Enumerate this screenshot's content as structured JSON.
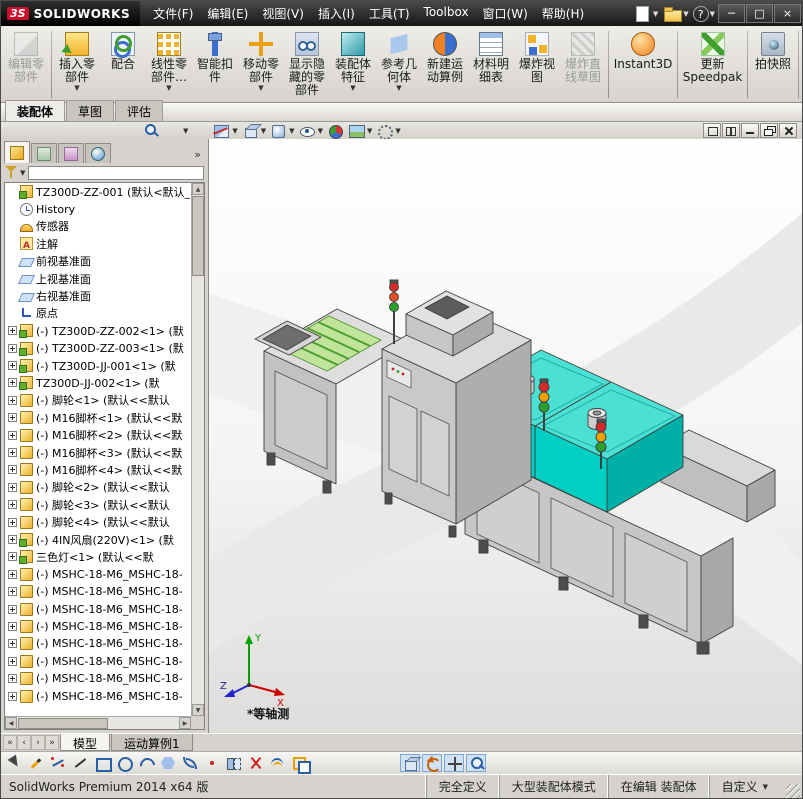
{
  "titlebar": {
    "logo_mark": "3S",
    "logo_text": "SOLIDWORKS",
    "menus": [
      "文件(F)",
      "编辑(E)",
      "视图(V)",
      "插入(I)",
      "工具(T)",
      "Toolbox",
      "窗口(W)",
      "帮助(H)"
    ],
    "quick_icons": [
      {
        "name": "new-document-icon",
        "glyph": ""
      },
      {
        "name": "open-document-icon",
        "glyph": ""
      },
      {
        "name": "help-icon",
        "glyph": "?"
      }
    ],
    "caret": "▼",
    "window_buttons": [
      {
        "name": "minimize-window-button",
        "glyph": "─"
      },
      {
        "name": "maximize-window-button",
        "glyph": "□"
      },
      {
        "name": "close-window-button",
        "glyph": "×"
      }
    ]
  },
  "ribbon": {
    "buttons": [
      {
        "name": "edit-component-button",
        "icon": "edit-component",
        "label": "编辑零\n部件",
        "disabled": true
      },
      {
        "name": "ribbon-separator",
        "icon": "sep",
        "label": "",
        "inter": "false"
      },
      {
        "name": "insert-component-button",
        "icon": "insert-component",
        "label": "插入零\n部件",
        "caret": "▼"
      },
      {
        "name": "mate-button",
        "icon": "mate",
        "label": "配合"
      },
      {
        "name": "linear-pattern-button",
        "icon": "linear-pattern",
        "label": "线性零\n部件…",
        "caret": "▼"
      },
      {
        "name": "smart-fastener-button",
        "icon": "smart-fastener",
        "label": "智能扣\n件"
      },
      {
        "name": "move-component-button",
        "icon": "move-component",
        "label": "移动零\n部件",
        "caret": "▼"
      },
      {
        "name": "show-hidden-components-button",
        "icon": "show-hidden",
        "label": "显示隐\n藏的零\n部件"
      },
      {
        "name": "assembly-features-button",
        "icon": "assembly-features",
        "label": "装配体\n特征",
        "caret": "▼"
      },
      {
        "name": "reference-geometry-button",
        "icon": "reference-geometry",
        "label": "参考几\n何体",
        "caret": "▼"
      },
      {
        "name": "new-motion-study-button",
        "icon": "motion-study",
        "label": "新建运\n动算例"
      },
      {
        "name": "bill-of-materials-button",
        "icon": "bom",
        "label": "材料明\n细表"
      },
      {
        "name": "exploded-view-button",
        "icon": "exploded-view",
        "label": "爆炸视\n图"
      },
      {
        "name": "explode-line-sketch-button",
        "icon": "explode-sketch",
        "label": "爆炸直\n线草图",
        "disabled": true
      },
      {
        "name": "ribbon-separator",
        "icon": "sep",
        "label": "",
        "inter": "false"
      },
      {
        "name": "instant3d-button",
        "icon": "instant3d",
        "label": "Instant3D"
      },
      {
        "name": "ribbon-separator",
        "icon": "sep",
        "label": "",
        "inter": "false"
      },
      {
        "name": "update-speedpak-button",
        "icon": "speedpak",
        "label": "更新\nSpeedpak"
      },
      {
        "name": "ribbon-separator",
        "icon": "sep",
        "label": "",
        "inter": "false"
      },
      {
        "name": "take-snapshot-button",
        "icon": "snapshot",
        "label": "拍快照"
      },
      {
        "name": "ribbon-separator",
        "icon": "sep",
        "label": "",
        "inter": "false"
      }
    ]
  },
  "command_tabs": [
    {
      "label": "装配体",
      "active": "true"
    },
    {
      "label": "草图",
      "active": "false"
    },
    {
      "label": "评估",
      "active": "false"
    }
  ],
  "huds": {
    "caret": "▼",
    "icons": [
      "zoom-fit-icon",
      "zoom-area-icon",
      "previous-view-icon",
      "section-view-icon",
      "view-orientation-icon",
      "display-style-icon",
      "hide-show-items-icon",
      "edit-appearance-icon",
      "apply-scene-icon",
      "view-settings-icon"
    ],
    "doc_window_buttons": [
      "doc-cascade-icon",
      "doc-tile-icon",
      "doc-minimize-icon",
      "doc-restore-icon",
      "doc-close-icon"
    ]
  },
  "panel": {
    "tabs": [
      "feature-manager-tab",
      "property-manager-tab",
      "configuration-manager-tab",
      "display-manager-tab"
    ],
    "expand_glyph": "»",
    "filter_caret": "▼"
  },
  "tree": {
    "items": [
      {
        "icon": "assembly-top",
        "label": "TZ300D-ZZ-001 (默认<默认_"
      },
      {
        "icon": "history",
        "label": "History"
      },
      {
        "icon": "sensors",
        "label": "传感器"
      },
      {
        "icon": "annotations",
        "label": "注解"
      },
      {
        "icon": "plane",
        "label": "前视基准面"
      },
      {
        "icon": "plane",
        "label": "上视基准面"
      },
      {
        "icon": "plane",
        "label": "右视基准面"
      },
      {
        "icon": "origin",
        "label": "原点"
      },
      {
        "box": "+",
        "icon": "assembly",
        "label": "(-) TZ300D-ZZ-002<1> (默"
      },
      {
        "box": "+",
        "icon": "assembly",
        "label": "(-) TZ300D-ZZ-003<1> (默"
      },
      {
        "box": "+",
        "icon": "assembly",
        "label": "(-) TZ300D-JJ-001<1> (默"
      },
      {
        "box": "+",
        "icon": "assembly",
        "label": "TZ300D-JJ-002<1> (默"
      },
      {
        "box": "+",
        "icon": "part",
        "label": "(-) 脚轮<1> (默认<<默认"
      },
      {
        "box": "+",
        "icon": "part",
        "label": "(-) M16脚杯<1> (默认<<默"
      },
      {
        "box": "+",
        "icon": "part",
        "label": "(-) M16脚杯<2> (默认<<默"
      },
      {
        "box": "+",
        "icon": "part",
        "label": "(-) M16脚杯<3> (默认<<默"
      },
      {
        "box": "+",
        "icon": "part",
        "label": "(-) M16脚杯<4> (默认<<默"
      },
      {
        "box": "+",
        "icon": "part",
        "label": "(-) 脚轮<2> (默认<<默认"
      },
      {
        "box": "+",
        "icon": "part",
        "label": "(-) 脚轮<3> (默认<<默认"
      },
      {
        "box": "+",
        "icon": "part",
        "label": "(-) 脚轮<4> (默认<<默认"
      },
      {
        "box": "+",
        "icon": "assembly",
        "label": "(-) 4IN风扇(220V)<1> (默"
      },
      {
        "box": "+",
        "icon": "assembly",
        "label": "三色灯<1> (默认<<默"
      },
      {
        "box": "+",
        "icon": "part",
        "label": "(-) MSHC-18-M6_MSHC-18-"
      },
      {
        "box": "+",
        "icon": "part",
        "label": "(-) MSHC-18-M6_MSHC-18-"
      },
      {
        "box": "+",
        "icon": "part",
        "label": "(-) MSHC-18-M6_MSHC-18-"
      },
      {
        "box": "+",
        "icon": "part",
        "label": "(-) MSHC-18-M6_MSHC-18-"
      },
      {
        "box": "+",
        "icon": "part",
        "label": "(-) MSHC-18-M6_MSHC-18-"
      },
      {
        "box": "+",
        "icon": "part",
        "label": "(-) MSHC-18-M6_MSHC-18-"
      },
      {
        "box": "+",
        "icon": "part",
        "label": "(-) MSHC-18-M6_MSHC-18-"
      },
      {
        "box": "+",
        "icon": "part",
        "label": "(-) MSHC-18-M6_MSHC-18-"
      }
    ],
    "scroll": {
      "up": "▲",
      "down": "▼",
      "left": "◀",
      "right": "▶"
    }
  },
  "graphics": {
    "view_label": "*等轴测",
    "triad": {
      "x": "X",
      "y": "Y",
      "z": "Z"
    },
    "model_colors": {
      "chamber_cyan": "#00cfc2",
      "body_gray": "#c6c6c6",
      "light_red": "#d42a2a",
      "light_yellow": "#f0a000",
      "light_green": "#2ca02c"
    }
  },
  "model_tabs": {
    "arrows": [
      "«",
      "‹",
      "›",
      "»"
    ],
    "tabs": [
      {
        "label": "模型",
        "active": "true"
      },
      {
        "label": "运动算例1",
        "active": "false"
      }
    ]
  },
  "sketchbar": {
    "icons": [
      "select-icon",
      "sketch-icon",
      "smart-dimension-icon",
      "line-icon",
      "rectangle-icon",
      "circle-icon",
      "arc-icon",
      "polygon-icon",
      "spline-icon",
      "point-icon",
      "mirror-icon",
      "trim-icon",
      "offset-icon",
      "convert-entities-icon"
    ],
    "view_icons": [
      "view-cube-icon",
      "rotate-view-icon",
      "pan-view-icon",
      "zoom-view-icon"
    ]
  },
  "statusbar": {
    "left": "SolidWorks Premium 2014 x64 版",
    "segments": [
      {
        "label": "完全定义"
      },
      {
        "label": "大型装配体模式"
      },
      {
        "label": "在编辑 装配体"
      },
      {
        "label": "自定义",
        "caret": "▼"
      }
    ]
  }
}
